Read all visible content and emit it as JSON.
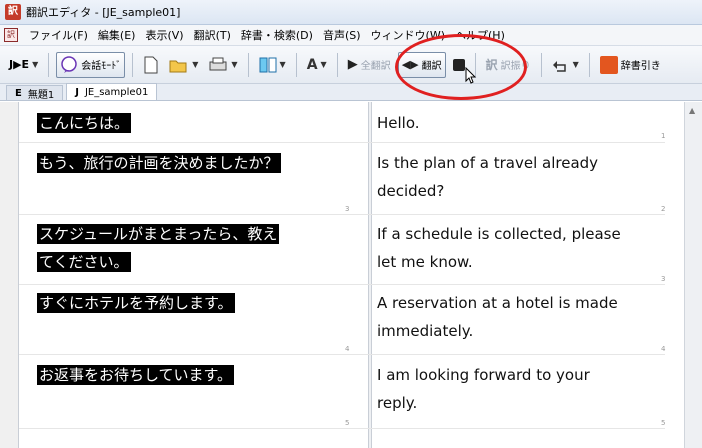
{
  "window": {
    "title": "翻訳エディタ - [JE_sample01]",
    "app_icon_glyph": "訳"
  },
  "menu": {
    "doc_icon_glyph": "訳",
    "items": [
      "ファイル(F)",
      "編集(E)",
      "表示(V)",
      "翻訳(T)",
      "辞書・検索(D)",
      "音声(S)",
      "ウィンドウ(W)",
      "ヘルプ(H)"
    ]
  },
  "toolbar": {
    "direction": "J▶E",
    "speech_label": "会話ﾓｰﾄﾞ",
    "translate_all_label": "全翻訳",
    "translate_label": "翻訳",
    "parallel_label": "訳振り",
    "dictionary_label": "辞書引き"
  },
  "tabs": [
    {
      "prefix": "E",
      "label": "無題1"
    },
    {
      "prefix": "J",
      "label": "JE_sample01"
    }
  ],
  "rows": [
    {
      "num": "1",
      "source": [
        "こんにちは。"
      ],
      "target": [
        "Hello."
      ]
    },
    {
      "num": "2",
      "source": [
        "もう、旅行の計画を決めましたか？"
      ],
      "target": [
        "Is the plan of a travel already",
        "decided?"
      ]
    },
    {
      "num": "3",
      "source": [
        "スケジュールがまとまったら、教え",
        "てください。"
      ],
      "target": [
        "If a schedule is collected, please",
        "let me know."
      ]
    },
    {
      "num": "4",
      "source": [
        "すぐにホテルを予約します。"
      ],
      "target": [
        "A reservation at a hotel is made",
        "immediately."
      ]
    },
    {
      "num": "5",
      "source": [
        "お返事をお待ちしています。"
      ],
      "target": [
        "I am looking forward to your",
        "reply."
      ]
    }
  ],
  "colors": {
    "highlight": "#e02020",
    "source_bg": "#000000"
  }
}
